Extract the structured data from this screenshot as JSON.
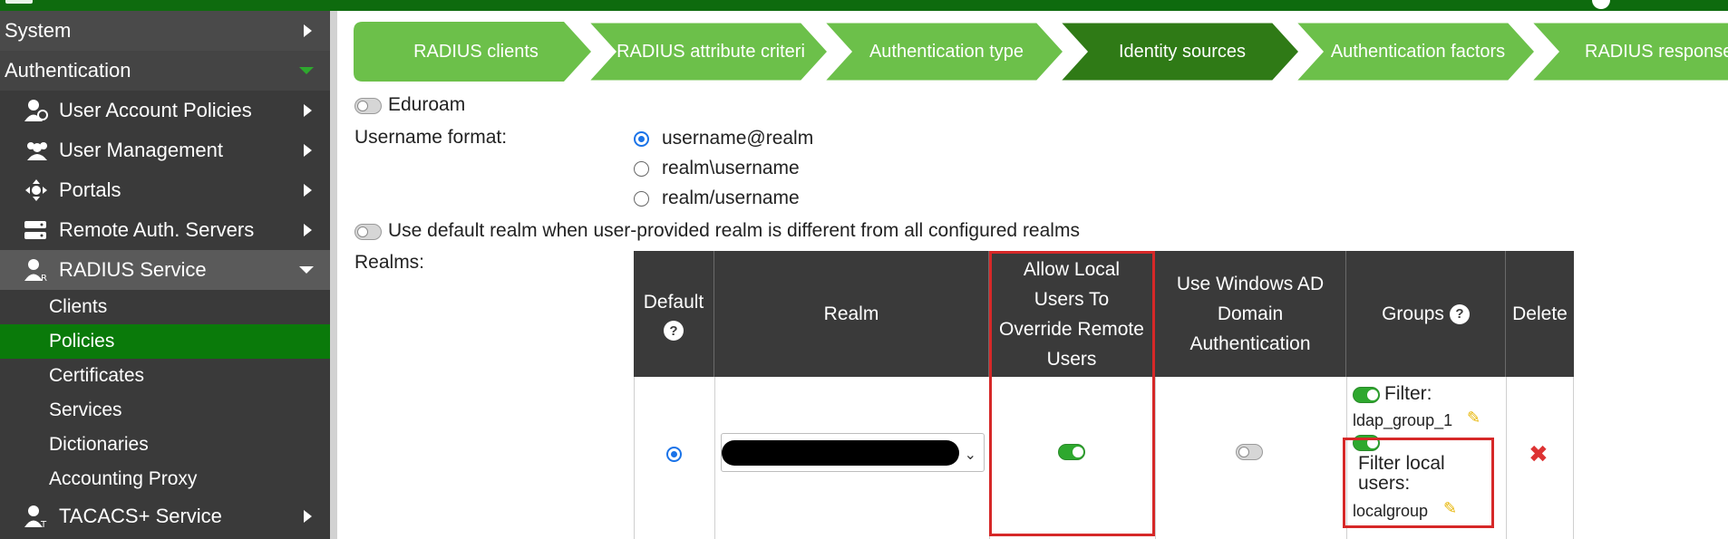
{
  "sidebar": {
    "items": [
      {
        "label": "System",
        "icon": "none"
      },
      {
        "label": "Authentication",
        "icon": "none"
      },
      {
        "label": "User Account Policies",
        "icon": "user-policy-icon"
      },
      {
        "label": "User Management",
        "icon": "users-icon"
      },
      {
        "label": "Portals",
        "icon": "portals-icon"
      },
      {
        "label": "Remote Auth. Servers",
        "icon": "servers-icon"
      },
      {
        "label": "RADIUS Service",
        "icon": "radius-user-icon"
      },
      {
        "label": "TACACS+ Service",
        "icon": "tacacs-user-icon"
      }
    ],
    "sub_items": [
      "Clients",
      "Policies",
      "Certificates",
      "Services",
      "Dictionaries",
      "Accounting Proxy"
    ],
    "selected": "Policies"
  },
  "wizard": {
    "steps": [
      "RADIUS clients",
      "RADIUS attribute criteri",
      "Authentication type",
      "Identity sources",
      "Authentication factors",
      "RADIUS response"
    ],
    "active_step": "Identity sources",
    "colors": {
      "inactive": "#6cc04a",
      "active": "#2f7a16"
    }
  },
  "form": {
    "eduroam_label": "Eduroam",
    "username_format_label": "Username format:",
    "username_formats": [
      "username@realm",
      "realm\\username",
      "realm/username"
    ],
    "username_format_selected": "username@realm",
    "default_realm_label": "Use default realm when user-provided realm is different from all configured realms",
    "realms_label": "Realms:"
  },
  "table": {
    "headers": {
      "default": "Default",
      "realm": "Realm",
      "allow_local": "Allow Local Users To Override Remote Users",
      "windows_ad": "Use Windows AD Domain Authentication",
      "groups": "Groups",
      "delete": "Delete"
    },
    "row": {
      "filter_label": "Filter:",
      "filter_value": "ldap_group_1",
      "filter_local_label": "Filter local users:",
      "filter_local_value": "localgroup",
      "allow_local_on": true,
      "windows_ad_on": false
    }
  },
  "colors": {
    "topbar": "#0e6b0e",
    "sidebar_bg": "#3a3a3a",
    "selected_item": "#0a7a0a",
    "highlight_box": "#d62828"
  }
}
